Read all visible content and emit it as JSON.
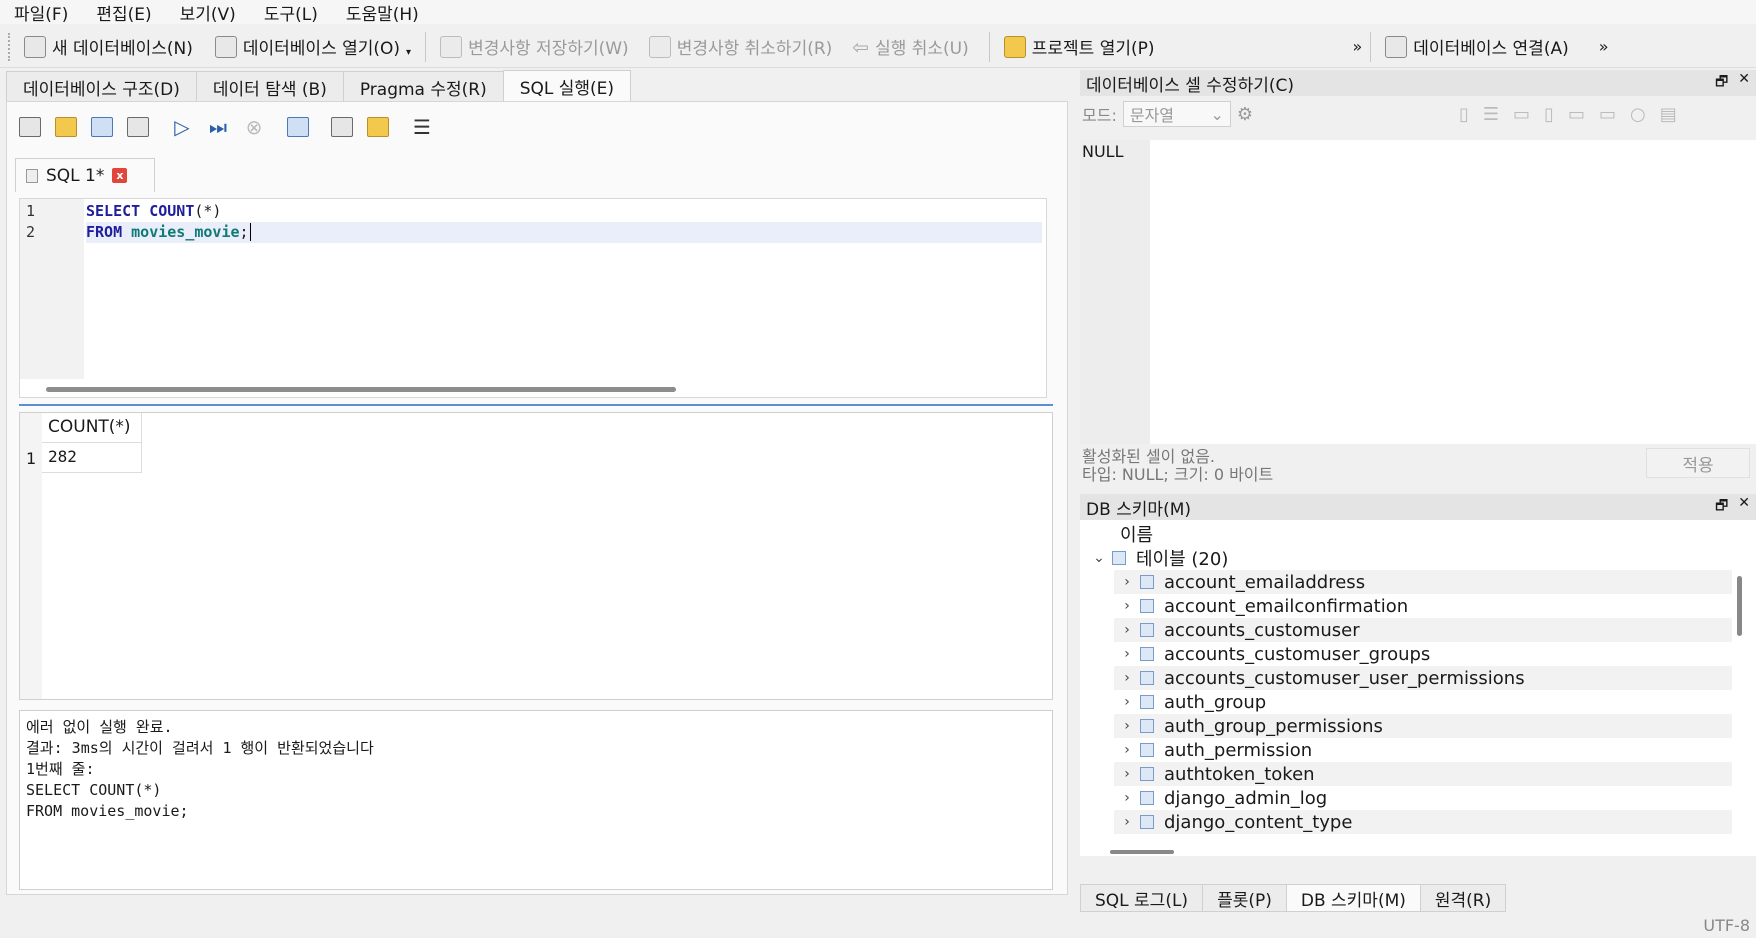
{
  "menu": [
    "파일(F)",
    "편집(E)",
    "보기(V)",
    "도구(L)",
    "도움말(H)"
  ],
  "toolbar": {
    "new_db": "새 데이터베이스(N)",
    "open_db": "데이터베이스 열기(O)",
    "write_changes": "변경사항 저장하기(W)",
    "revert_changes": "변경사항 취소하기(R)",
    "undo": "실행 취소(U)",
    "open_project": "프로젝트 열기(P)",
    "overflow": "»",
    "connect_db": "데이터베이스 연결(A)",
    "overflow2": "»"
  },
  "main_tabs": [
    "데이터베이스 구조(D)",
    "데이터 탐색 (B)",
    "Pragma 수정(R)",
    "SQL 실행(E)"
  ],
  "sql_tab": {
    "label": "SQL 1*"
  },
  "editor": {
    "line_numbers": [
      "1",
      "2"
    ],
    "line1": {
      "kw1": "SELECT",
      "fn": "COUNT",
      "rest": "(*)"
    },
    "line2": {
      "kw": "FROM",
      "table": "movies_movie",
      "end": ";"
    }
  },
  "results": {
    "header": "COUNT(*)",
    "row_num": "1",
    "value": "282"
  },
  "message": {
    "line1": "에러 없이 실행 완료.",
    "line2": "결과: 3ms의 시간이 걸려서 1 행이 반환되었습니다",
    "line3": "1번째 줄:",
    "line4": "SELECT COUNT(*)",
    "line5": "FROM movies_movie;"
  },
  "cell_editor": {
    "title": "데이터베이스 셀 수정하기(C)",
    "mode_label": "모드:",
    "mode_value": "문자열",
    "value": "NULL",
    "info1": "활성화된 셀이 없음.",
    "info2": "타입: NULL; 크기: 0 바이트",
    "apply": "적용"
  },
  "schema": {
    "title": "DB 스키마(M)",
    "col_header": "이름",
    "root": "테이블 (20)",
    "tables": [
      "account_emailaddress",
      "account_emailconfirmation",
      "accounts_customuser",
      "accounts_customuser_groups",
      "accounts_customuser_user_permissions",
      "auth_group",
      "auth_group_permissions",
      "auth_permission",
      "authtoken_token",
      "django_admin_log",
      "django_content_type"
    ]
  },
  "bottom_tabs": [
    "SQL 로그(L)",
    "플롯(P)",
    "DB 스키마(M)",
    "원격(R)"
  ],
  "status": {
    "encoding": "UTF-8"
  },
  "pane_buttons": {
    "float": "🗗",
    "close": "✕"
  }
}
